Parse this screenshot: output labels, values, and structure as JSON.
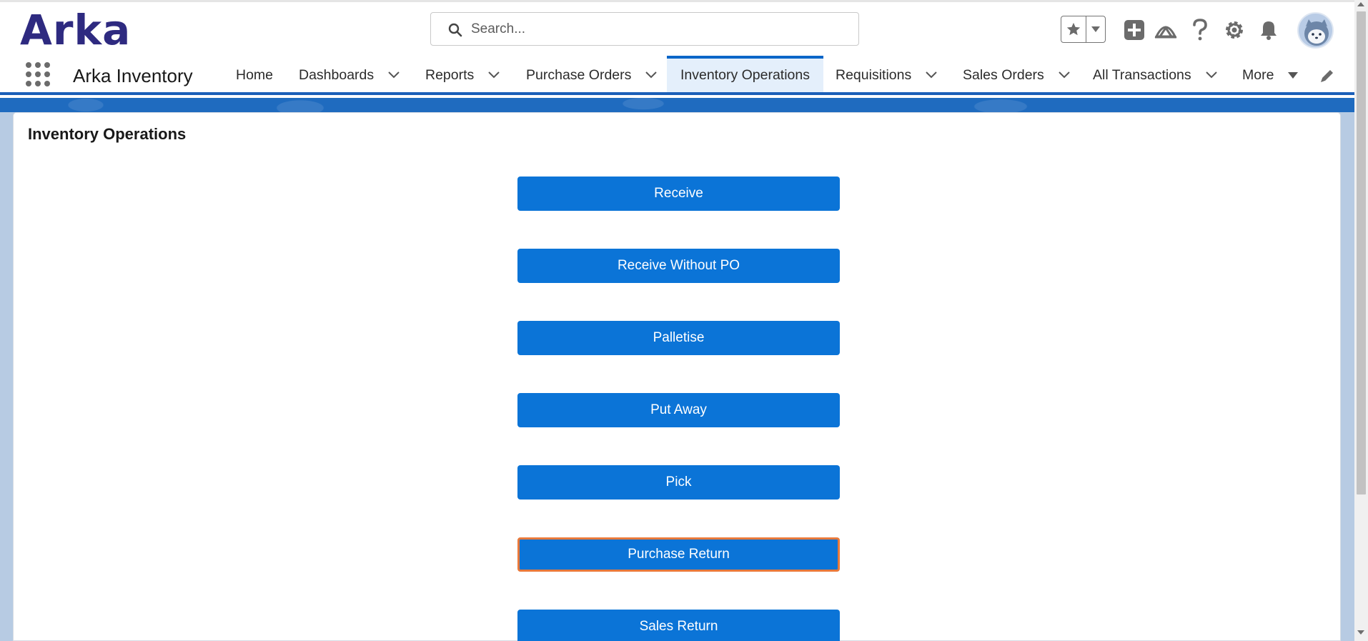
{
  "header": {
    "logo_text": "Arka",
    "search": {
      "placeholder": "Search...",
      "value": ""
    },
    "icons": [
      "favorites-star-icon",
      "favorites-dropdown-icon",
      "global-add-icon",
      "trailhead-icon",
      "help-icon",
      "setup-gear-icon",
      "notifications-bell-icon",
      "user-avatar"
    ]
  },
  "nav": {
    "app_name": "Arka Inventory",
    "items": [
      {
        "label": "Home",
        "has_menu": false
      },
      {
        "label": "Dashboards",
        "has_menu": true
      },
      {
        "label": "Reports",
        "has_menu": true
      },
      {
        "label": "Purchase Orders",
        "has_menu": true
      },
      {
        "label": "Inventory Operations",
        "has_menu": false,
        "active": true
      },
      {
        "label": "Requisitions",
        "has_menu": true
      },
      {
        "label": "Sales Orders",
        "has_menu": true
      },
      {
        "label": "All Transactions",
        "has_menu": true
      },
      {
        "label": "More",
        "has_menu": true
      }
    ]
  },
  "page": {
    "title": "Inventory Operations",
    "buttons": [
      {
        "label": "Receive"
      },
      {
        "label": "Receive Without PO"
      },
      {
        "label": "Palletise"
      },
      {
        "label": "Put Away"
      },
      {
        "label": "Pick"
      },
      {
        "label": "Purchase Return",
        "focused": true
      },
      {
        "label": "Sales Return"
      }
    ]
  },
  "colors": {
    "brand": "#2e2a80",
    "primary_button": "#0b74d7",
    "focus_ring": "#e8793b",
    "nav_active_bg": "#e4effb",
    "band": "#1f6bbf"
  }
}
